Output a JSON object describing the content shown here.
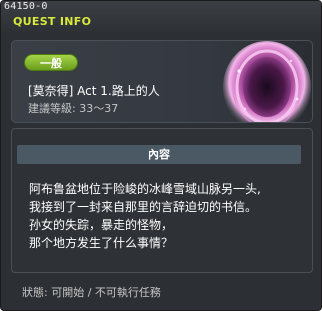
{
  "window": {
    "id": "64150-0",
    "title": "QUEST INFO"
  },
  "quest": {
    "category": "一般",
    "name": "[莫奈得] Act 1.路上的人",
    "level": "建議等級: 33～37",
    "illustration": "portal-illustration"
  },
  "content": {
    "header": "內容",
    "lines": [
      "阿布鲁盆地位于险峻的冰峰雪域山脉另一头,",
      "我接到了一封来自那里的言辞迫切的书信。",
      "孙女的失踪，暴走的怪物，",
      "那个地方发生了什么事情？"
    ]
  },
  "status": "狀態: 可開始 / 不可執行任務",
  "colors": {
    "panel_bg": "#2c2f33",
    "title": "#d8ea3c",
    "badge": "#8cc23a",
    "section_header": "#4b5965"
  }
}
